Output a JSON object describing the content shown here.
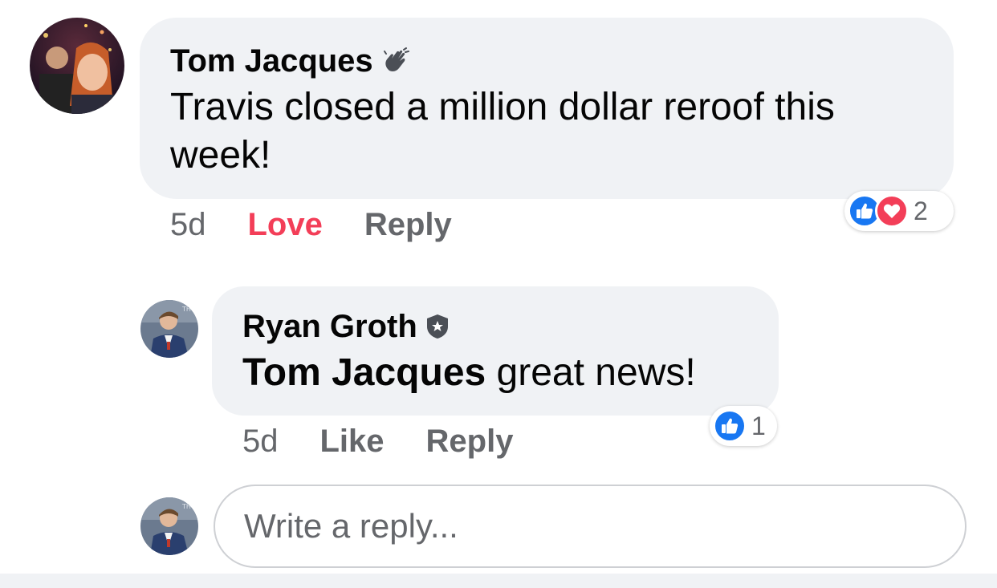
{
  "comment": {
    "author": "Tom Jacques",
    "author_badge_icon": "wave-icon",
    "text": "Travis closed a million dollar reroof this week!",
    "time": "5d",
    "reaction_label": "Love",
    "reaction_color": "#f33e58",
    "reply_label": "Reply",
    "reactions": [
      "like",
      "love"
    ],
    "reaction_count": "2"
  },
  "reply": {
    "author": "Ryan Groth",
    "author_badge_icon": "verified-shield-icon",
    "mention": "Tom Jacques",
    "text": " great news!",
    "time": "5d",
    "like_label": "Like",
    "reply_label": "Reply",
    "reactions": [
      "like"
    ],
    "reaction_count": "1"
  },
  "composer": {
    "placeholder": "Write a reply..."
  },
  "colors": {
    "bubble": "#f0f2f5",
    "secondary_text": "#65676b",
    "like_blue": "#1877f2",
    "love_red": "#f33e58"
  }
}
